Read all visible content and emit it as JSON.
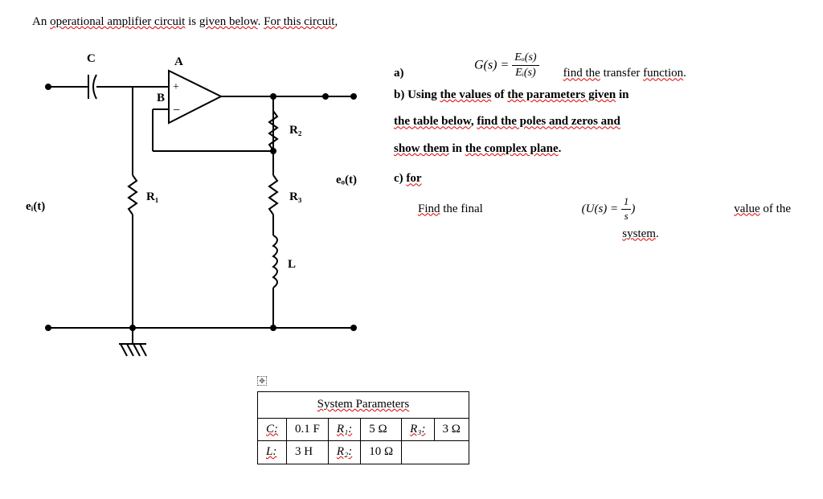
{
  "intro": {
    "p1": "An ",
    "p2": "operational amplifier circuit",
    "p3": " is ",
    "p4": "given below",
    "p5": ". ",
    "p6": "For this circuit",
    "p7": ","
  },
  "labels": {
    "C": "C",
    "A": "A",
    "B": "B",
    "R1": "R₁",
    "R2": "R₂",
    "R3": "R₃",
    "L": "L",
    "ei": "eᵢ(t)",
    "eo": "eₒ(t)"
  },
  "eq": {
    "lhs": "G(s) = ",
    "num": "Eₒ(s)",
    "den": "Eᵢ(s)"
  },
  "qa": {
    "a_prefix": "a)",
    "a_text1": "find the",
    "a_text2": " transfer ",
    "a_text3": "function",
    "b_prefix": "b)  ",
    "b_t1": "Using ",
    "b_t2": "the values",
    "b_t3": " of ",
    "b_t4": "the parameters given",
    "b_t5": " in",
    "b_line2_1": "the table below",
    "b_line2_2": ", ",
    "b_line2_3": "find the poles and zeros and",
    "b_line3_1": "show them",
    "b_line3_2": " in ",
    "b_line3_3": "the complex plane",
    "b_line3_4": ".",
    "c_prefix": "c)  ",
    "c_for": "for",
    "c_find": "Find",
    "c_the_final": " the final",
    "c_value": "value",
    "c_of_the": " of the",
    "c_system": "system",
    "ueq_l": "(U(s) = ",
    "ueq_num": "1",
    "ueq_den": "s",
    "ueq_r": ")"
  },
  "table": {
    "title": "System Parameters",
    "C_lbl": "C:",
    "C_val": "0.1 F",
    "R1_lbl": "R₁:",
    "R1_val": "5 Ω",
    "R3_lbl": "R₃:",
    "R3_val": "3 Ω",
    "L_lbl": "L:",
    "L_val": "3 H",
    "R2_lbl": "R₂:",
    "R2_val": "10 Ω"
  }
}
